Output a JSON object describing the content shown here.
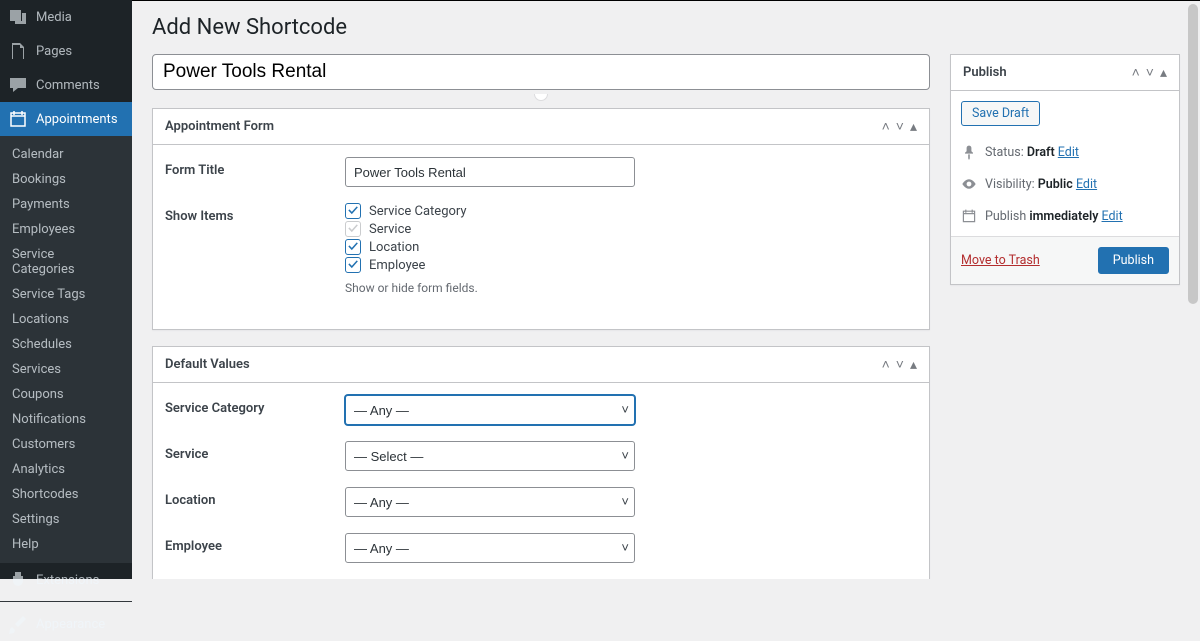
{
  "sidebar": {
    "top": [
      {
        "label": "Media",
        "icon": "media"
      },
      {
        "label": "Pages",
        "icon": "pages"
      },
      {
        "label": "Comments",
        "icon": "comments"
      },
      {
        "label": "Appointments",
        "icon": "calendar",
        "active": true
      }
    ],
    "submenu": [
      "Calendar",
      "Bookings",
      "Payments",
      "Employees",
      "Service Categories",
      "Service Tags",
      "Locations",
      "Schedules",
      "Services",
      "Coupons",
      "Notifications",
      "Customers",
      "Analytics",
      "Shortcodes",
      "Settings",
      "Help"
    ],
    "extensions_label": "Extensions",
    "appearance_label": "Appearance"
  },
  "page": {
    "title": "Add New Shortcode",
    "title_input": "Power Tools Rental"
  },
  "appointment_form": {
    "box_title": "Appointment Form",
    "form_title_label": "Form Title",
    "form_title_value": "Power Tools Rental",
    "show_items_label": "Show Items",
    "items": [
      {
        "label": "Service Category",
        "checked": true
      },
      {
        "label": "Service",
        "checked": true,
        "dim": true
      },
      {
        "label": "Location",
        "checked": true
      },
      {
        "label": "Employee",
        "checked": true
      }
    ],
    "hint": "Show or hide form fields."
  },
  "default_values": {
    "box_title": "Default Values",
    "fields": [
      {
        "label": "Service Category",
        "value": "— Any —",
        "focused": true
      },
      {
        "label": "Service",
        "value": "— Select —"
      },
      {
        "label": "Location",
        "value": "— Any —"
      },
      {
        "label": "Employee",
        "value": "— Any —"
      }
    ]
  },
  "publish": {
    "box_title": "Publish",
    "save_draft": "Save Draft",
    "status_label": "Status:",
    "status_value": "Draft",
    "visibility_label": "Visibility:",
    "visibility_value": "Public",
    "publish_label": "Publish",
    "publish_time": "immediately",
    "edit_label": "Edit",
    "trash_label": "Move to Trash",
    "publish_button": "Publish"
  }
}
